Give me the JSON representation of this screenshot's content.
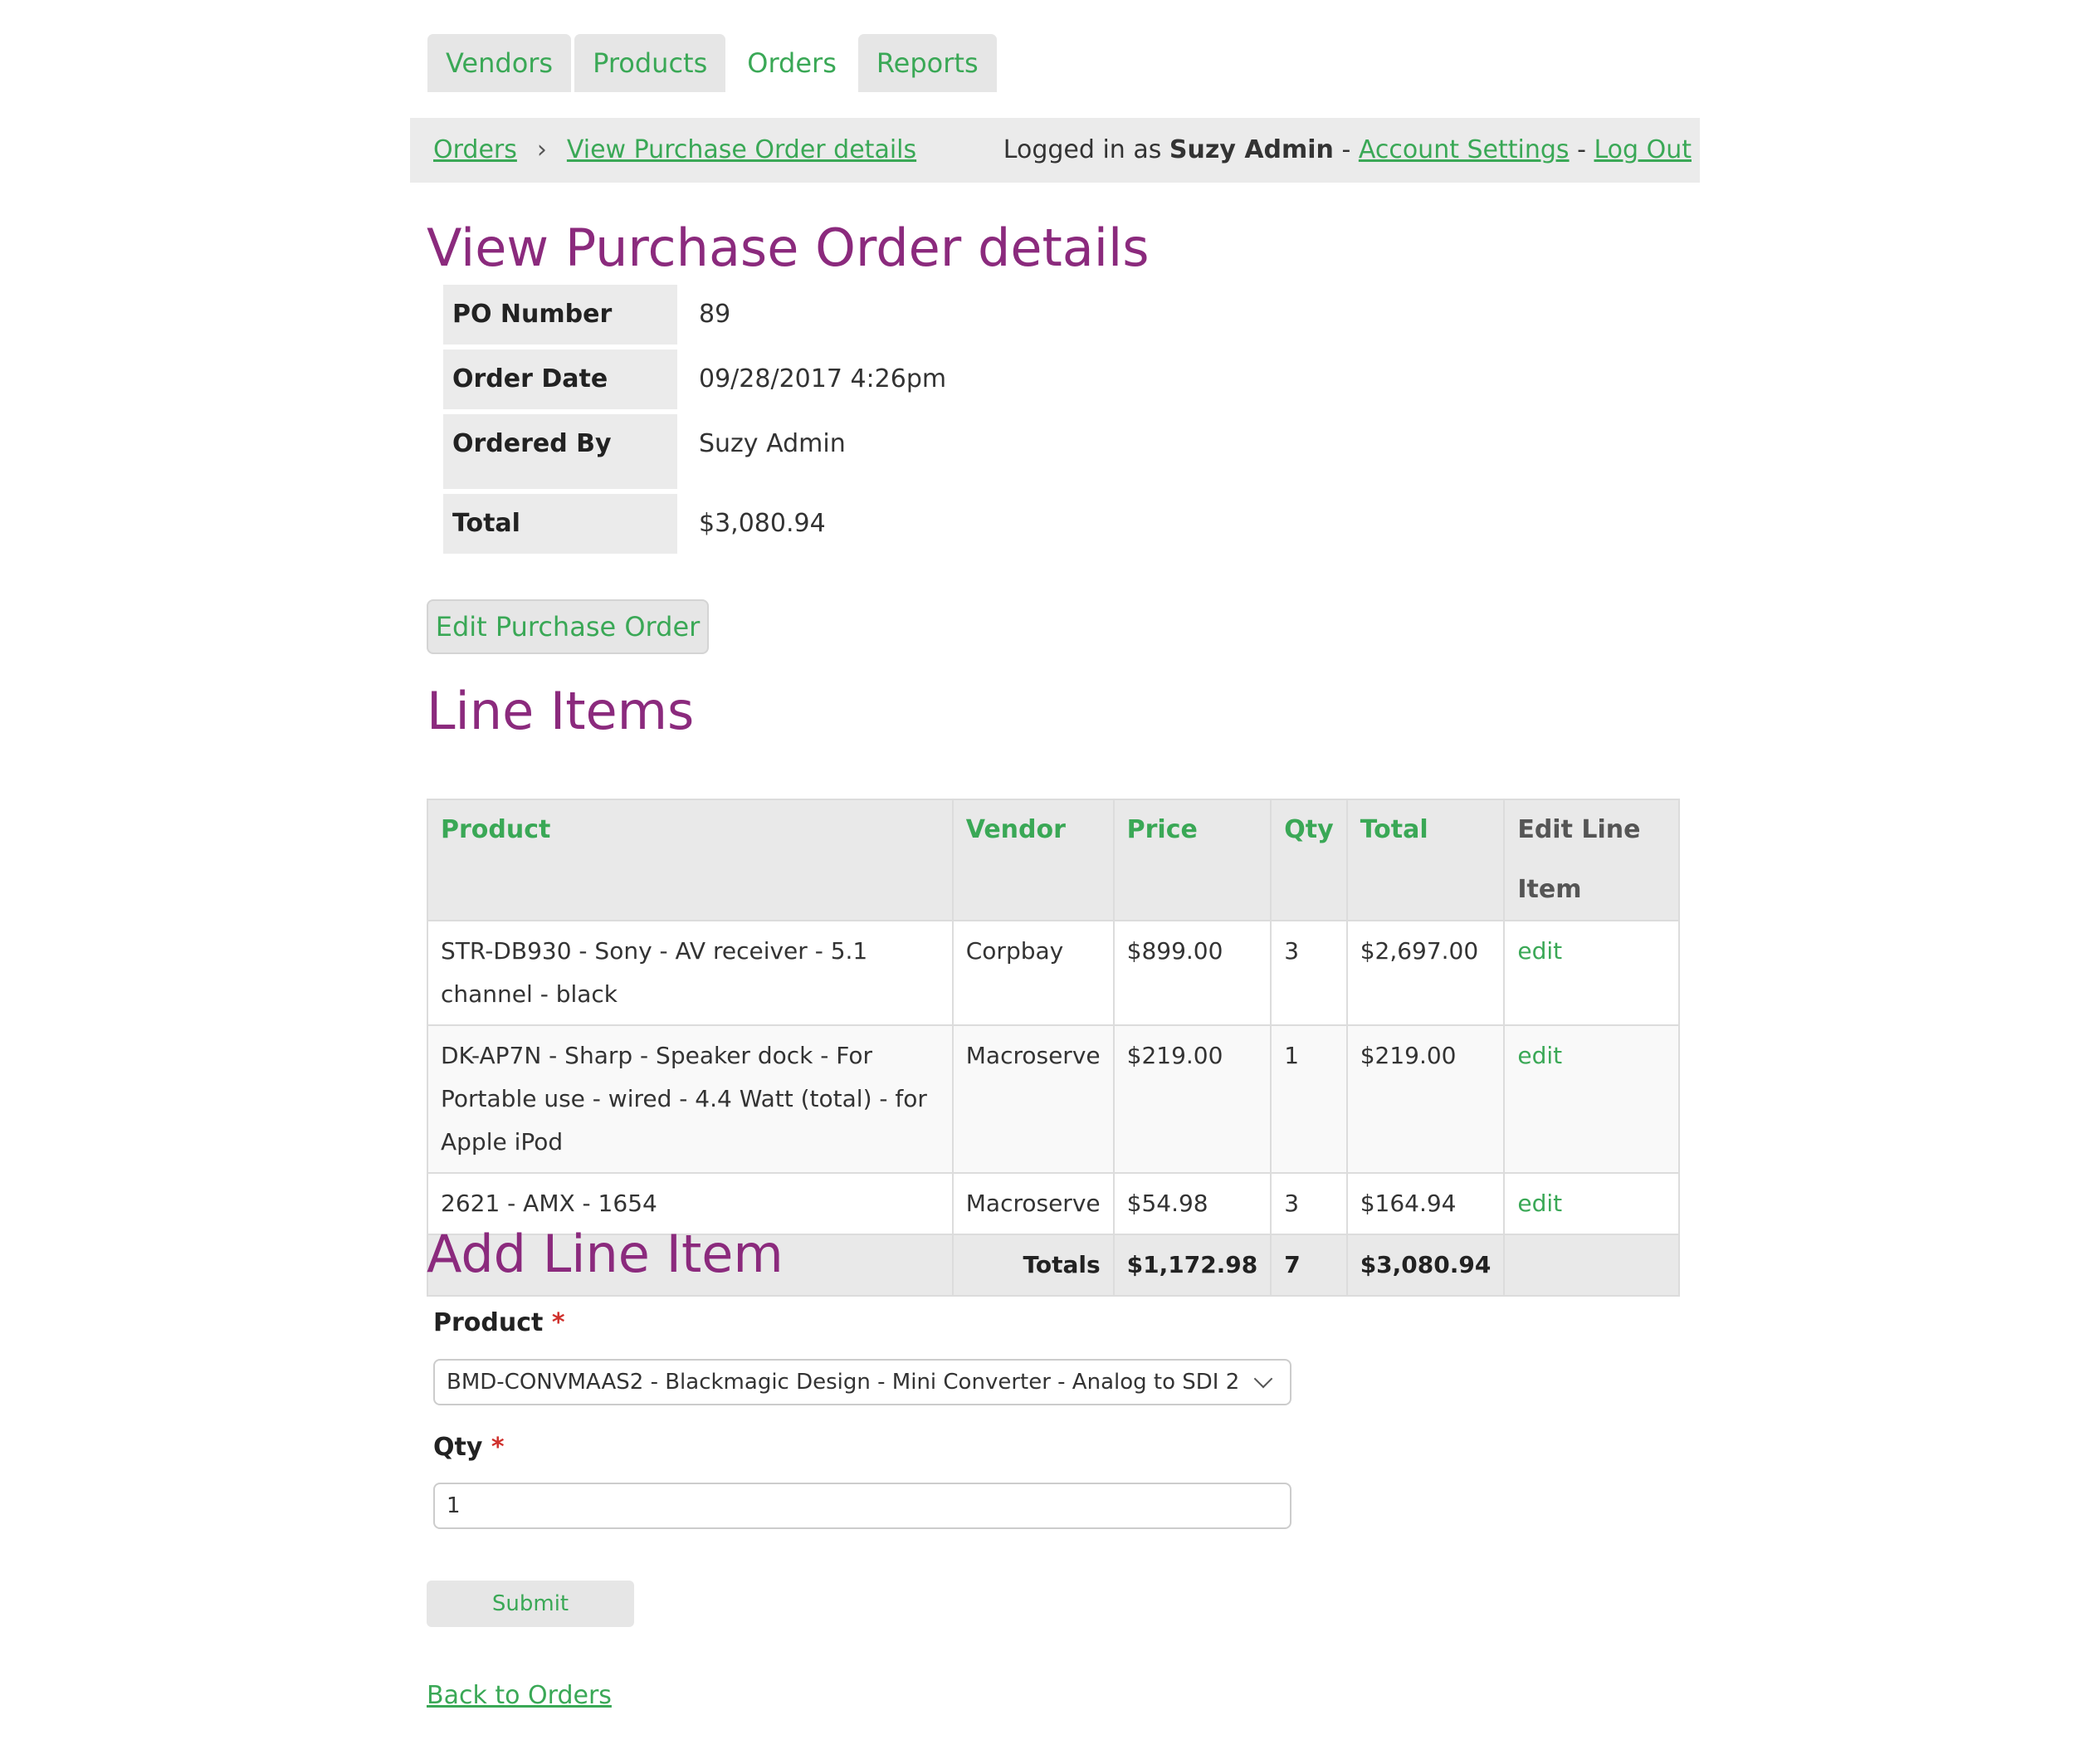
{
  "nav": {
    "tabs": [
      {
        "label": "Vendors",
        "active": false
      },
      {
        "label": "Products",
        "active": false
      },
      {
        "label": "Orders",
        "active": true
      },
      {
        "label": "Reports",
        "active": false
      }
    ]
  },
  "header": {
    "breadcrumb": [
      "Orders",
      "View Purchase Order details"
    ],
    "breadcrumb_separator": "›",
    "logged_in_prefix": "Logged in as",
    "user_name": "Suzy Admin",
    "dash": "-",
    "account_settings": "Account Settings",
    "log_out": "Log Out"
  },
  "page": {
    "title": "View Purchase Order details"
  },
  "details": {
    "po_number_label": "PO Number",
    "po_number": "89",
    "order_date_label": "Order Date",
    "order_date": "09/28/2017 4:26pm",
    "ordered_by_label": "Ordered By",
    "ordered_by": "Suzy Admin",
    "total_label": "Total",
    "total": "$3,080.94"
  },
  "edit_po_button": "Edit Purchase Order",
  "line_items": {
    "title": "Line Items",
    "columns": [
      "Product",
      "Vendor",
      "Price",
      "Qty",
      "Total",
      "Edit Line Item"
    ],
    "rows": [
      {
        "product": "STR-DB930 - Sony - AV receiver - 5.1 channel - black",
        "vendor": "Corpbay",
        "price": "$899.00",
        "qty": "3",
        "total": "$2,697.00",
        "edit": "edit"
      },
      {
        "product": "DK-AP7N - Sharp - Speaker dock - For Portable use - wired - 4.4 Watt (total) - for Apple iPod",
        "vendor": "Macroserve",
        "price": "$219.00",
        "qty": "1",
        "total": "$219.00",
        "edit": "edit"
      },
      {
        "product": "2621 - AMX - 1654",
        "vendor": "Macroserve",
        "price": "$54.98",
        "qty": "3",
        "total": "$164.94",
        "edit": "edit"
      }
    ],
    "totals": {
      "label": "Totals",
      "price": "$1,172.98",
      "qty": "7",
      "total": "$3,080.94"
    }
  },
  "add_line_item": {
    "title": "Add Line Item",
    "product_label": "Product",
    "required_mark": "*",
    "product_value": "BMD-CONVMAAS2 - Blackmagic Design - Mini Converter - Analog to SDI 2",
    "qty_label": "Qty",
    "qty_value": "1",
    "submit": "Submit"
  },
  "back_link": "Back to Orders",
  "colors": {
    "accent_green": "#3aa856",
    "heading_purple": "#8b2a7d",
    "required_red": "#d0312d"
  }
}
